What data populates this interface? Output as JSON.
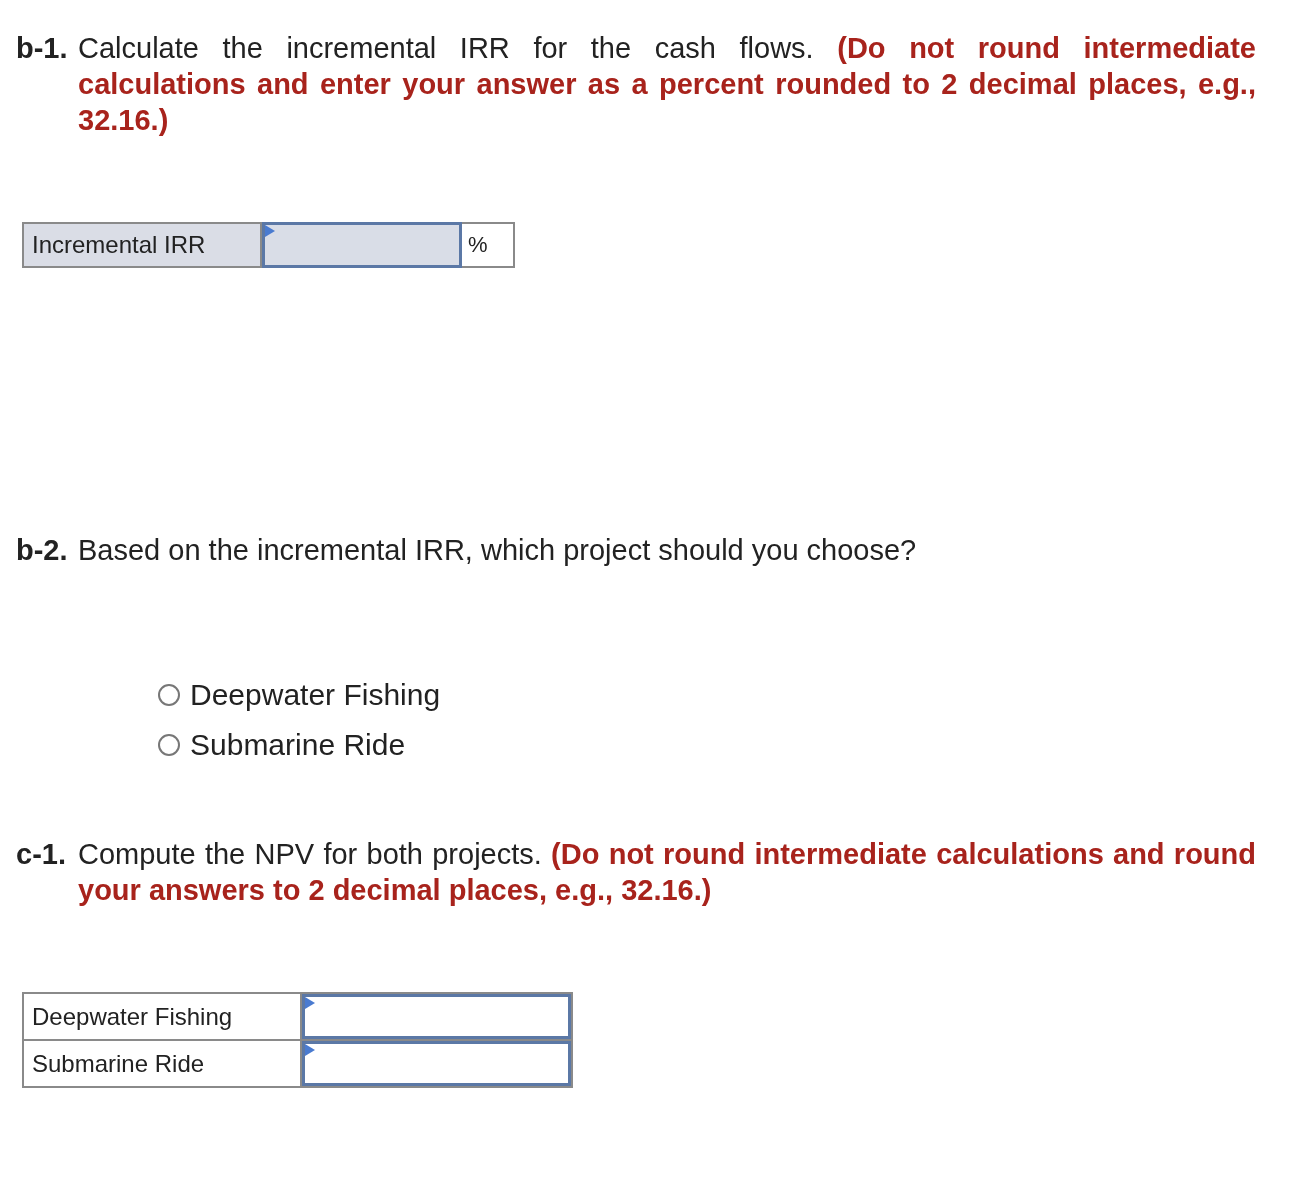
{
  "b1": {
    "number": "b-1.",
    "text": "Calculate the incremental IRR for the cash flows. **(Do not round intermediate calculations and enter your answer as a percent rounded to 2 decimal places, e.g., 32.16.)**",
    "row": {
      "label": "Incremental IRR",
      "unit": "%"
    }
  },
  "b2": {
    "number": "b-2.",
    "text": "Based on the incremental IRR, which project should you choose?",
    "options": [
      {
        "label": "Deepwater Fishing",
        "selected": false
      },
      {
        "label": "Submarine Ride",
        "selected": false
      }
    ]
  },
  "c1": {
    "number": "c-1.",
    "text": "Compute the NPV for both projects. **(Do not round intermediate calculations and round your answers to 2 decimal places, e.g., 32.16.)**",
    "rows": [
      {
        "label": "Deepwater Fishing"
      },
      {
        "label": "Submarine Ride"
      }
    ]
  }
}
